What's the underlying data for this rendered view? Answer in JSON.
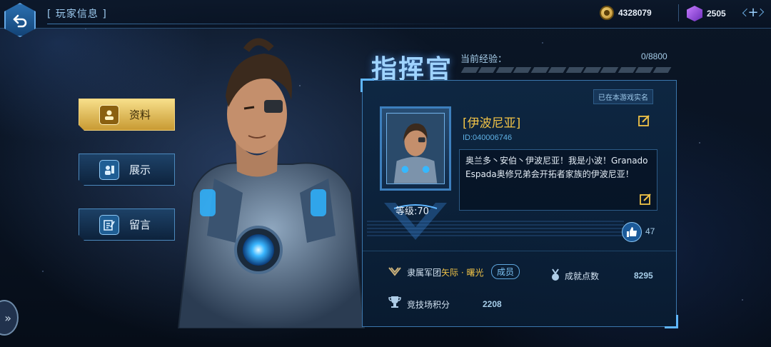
{
  "header": {
    "title": "[ 玩家信息 ]",
    "gold": "4328079",
    "gems": "2505"
  },
  "menu": [
    {
      "label": "资料",
      "active": true
    },
    {
      "label": "展示",
      "active": false
    },
    {
      "label": "留言",
      "active": false
    }
  ],
  "commander": {
    "title": "指挥官",
    "exp_label": "当前经验：",
    "exp_value": "0/8800",
    "exp_progress": 0
  },
  "card": {
    "verified": "已在本游戏实名",
    "name": "[伊波尼亚]",
    "id": "ID:040006746",
    "bio": "奥兰多丶安伯丶伊波尼亚！我是小波！GranadoEspada奥修兄弟会开拓者家族的伊波尼亚！",
    "level": "等级:70",
    "likes": "47",
    "legion_label": "隶属军团",
    "legion_name": "矢际 · 曙光",
    "legion_role": "成员",
    "achievement_label": "成就点数",
    "achievement_value": "8295",
    "arena_label": "竞技场积分",
    "arena_value": "2208"
  },
  "colors": {
    "accent": "#5fb6ff",
    "gold": "#f1c347",
    "active_button": "#e6c35c"
  }
}
